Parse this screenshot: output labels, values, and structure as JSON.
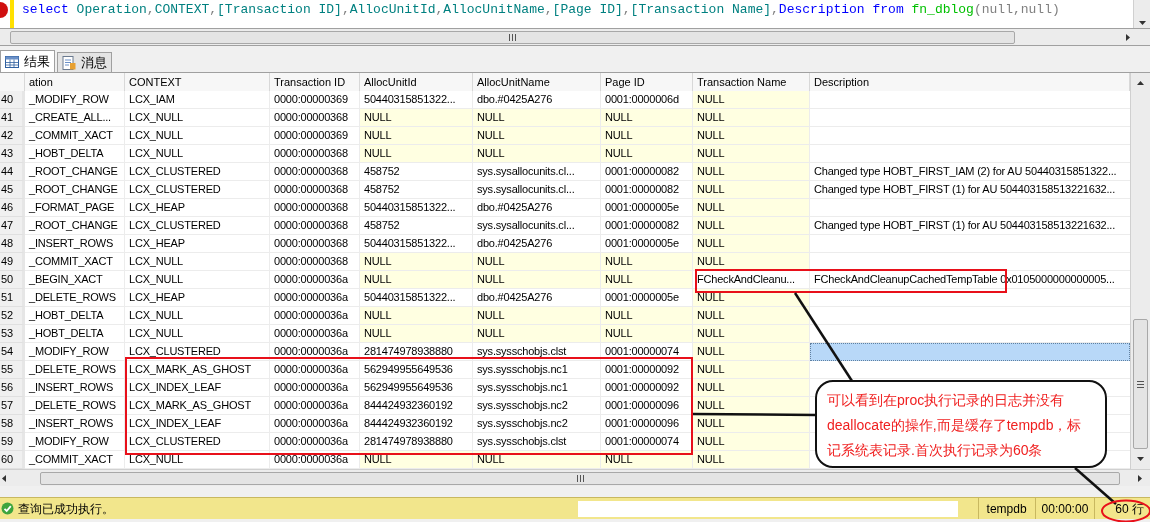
{
  "editor": {
    "code": [
      {
        "text": "select ",
        "kind": "keyword"
      },
      {
        "text": "Operation",
        "kind": "identifier"
      },
      {
        "text": ",",
        "kind": "punct"
      },
      {
        "text": "CONTEXT",
        "kind": "identifier"
      },
      {
        "text": ",",
        "kind": "punct"
      },
      {
        "text": "[Transaction ID]",
        "kind": "identifier"
      },
      {
        "text": ",",
        "kind": "punct"
      },
      {
        "text": "AllocUnitId",
        "kind": "identifier"
      },
      {
        "text": ",",
        "kind": "punct"
      },
      {
        "text": "AllocUnitName",
        "kind": "identifier"
      },
      {
        "text": ",",
        "kind": "punct"
      },
      {
        "text": "[Page ID]",
        "kind": "identifier"
      },
      {
        "text": ",",
        "kind": "punct"
      },
      {
        "text": "[Transaction Name]",
        "kind": "identifier"
      },
      {
        "text": ",",
        "kind": "punct"
      },
      {
        "text": "Description ",
        "kind": "keyword"
      },
      {
        "text": "from ",
        "kind": "keyword"
      },
      {
        "text": "fn_dblog",
        "kind": "function"
      },
      {
        "text": "(null,null)",
        "kind": "punct"
      }
    ]
  },
  "tabs": [
    {
      "label": "结果",
      "selected": true
    },
    {
      "label": "消息",
      "selected": false
    }
  ],
  "grid": {
    "columns": [
      "ation",
      "CONTEXT",
      "Transaction ID",
      "AllocUnitId",
      "AllocUnitName",
      "Page ID",
      "Transaction Name",
      "Description"
    ],
    "rows": [
      {
        "number": "40",
        "cells": [
          "_MODIFY_ROW",
          "LCX_IAM",
          "0000:00000369",
          "50440315851322...",
          "dbo.#0425A276",
          "0001:0000006d",
          "NULL"
        ],
        "shaded": [
          false,
          false,
          false,
          false,
          false,
          false,
          true
        ],
        "selected": false
      },
      {
        "number": "41",
        "cells": [
          "_CREATE_ALL...",
          "LCX_NULL",
          "0000:00000368",
          "NULL",
          "NULL",
          "NULL",
          "NULL"
        ],
        "shaded": [
          false,
          false,
          false,
          true,
          true,
          true,
          true
        ],
        "selected": false
      },
      {
        "number": "42",
        "cells": [
          "_COMMIT_XACT",
          "LCX_NULL",
          "0000:00000369",
          "NULL",
          "NULL",
          "NULL",
          "NULL"
        ],
        "shaded": [
          false,
          false,
          false,
          true,
          true,
          true,
          true
        ],
        "selected": false
      },
      {
        "number": "43",
        "cells": [
          "_HOBT_DELTA",
          "LCX_NULL",
          "0000:00000368",
          "NULL",
          "NULL",
          "NULL",
          "NULL"
        ],
        "shaded": [
          false,
          false,
          false,
          true,
          true,
          true,
          true
        ],
        "selected": false
      },
      {
        "number": "44",
        "cells": [
          "_ROOT_CHANGE",
          "LCX_CLUSTERED",
          "0000:00000368",
          "458752",
          "sys.sysallocunits.cl...",
          "0001:00000082",
          "NULL"
        ],
        "description": "Changed type HOBT_FIRST_IAM (2) for AU 50440315851322...",
        "shaded": [
          false,
          false,
          false,
          false,
          false,
          false,
          true
        ],
        "selected": false
      },
      {
        "number": "45",
        "cells": [
          "_ROOT_CHANGE",
          "LCX_CLUSTERED",
          "0000:00000368",
          "458752",
          "sys.sysallocunits.cl...",
          "0001:00000082",
          "NULL"
        ],
        "description": "Changed type HOBT_FIRST (1) for AU 504403158513221632...",
        "shaded": [
          false,
          false,
          false,
          false,
          false,
          false,
          true
        ],
        "selected": false
      },
      {
        "number": "46",
        "cells": [
          "_FORMAT_PAGE",
          "LCX_HEAP",
          "0000:00000368",
          "50440315851322...",
          "dbo.#0425A276",
          "0001:0000005e",
          "NULL"
        ],
        "shaded": [
          false,
          false,
          false,
          false,
          false,
          false,
          true
        ],
        "selected": false
      },
      {
        "number": "47",
        "cells": [
          "_ROOT_CHANGE",
          "LCX_CLUSTERED",
          "0000:00000368",
          "458752",
          "sys.sysallocunits.cl...",
          "0001:00000082",
          "NULL"
        ],
        "description": "Changed type HOBT_FIRST (1) for AU 504403158513221632...",
        "shaded": [
          false,
          false,
          false,
          false,
          false,
          false,
          true
        ],
        "selected": false
      },
      {
        "number": "48",
        "cells": [
          "_INSERT_ROWS",
          "LCX_HEAP",
          "0000:00000368",
          "50440315851322...",
          "dbo.#0425A276",
          "0001:0000005e",
          "NULL"
        ],
        "shaded": [
          false,
          false,
          false,
          false,
          false,
          false,
          true
        ],
        "selected": false
      },
      {
        "number": "49",
        "cells": [
          "_COMMIT_XACT",
          "LCX_NULL",
          "0000:00000368",
          "NULL",
          "NULL",
          "NULL",
          "NULL"
        ],
        "shaded": [
          false,
          false,
          false,
          true,
          true,
          true,
          true
        ],
        "selected": false
      },
      {
        "number": "50",
        "cells": [
          "_BEGIN_XACT",
          "LCX_NULL",
          "0000:0000036a",
          "NULL",
          "NULL",
          "NULL",
          "FCheckAndCleanu..."
        ],
        "description": "FCheckAndCleanupCachedTempTable 0x0105000000000005...",
        "shaded": [
          false,
          false,
          false,
          true,
          true,
          true,
          false
        ],
        "selected": false
      },
      {
        "number": "51",
        "cells": [
          "_DELETE_ROWS",
          "LCX_HEAP",
          "0000:0000036a",
          "50440315851322...",
          "dbo.#0425A276",
          "0001:0000005e",
          "NULL"
        ],
        "shaded": [
          false,
          false,
          false,
          false,
          false,
          false,
          true
        ],
        "selected": false
      },
      {
        "number": "52",
        "cells": [
          "_HOBT_DELTA",
          "LCX_NULL",
          "0000:0000036a",
          "NULL",
          "NULL",
          "NULL",
          "NULL"
        ],
        "shaded": [
          false,
          false,
          false,
          true,
          true,
          true,
          true
        ],
        "selected": false
      },
      {
        "number": "53",
        "cells": [
          "_HOBT_DELTA",
          "LCX_NULL",
          "0000:0000036a",
          "NULL",
          "NULL",
          "NULL",
          "NULL"
        ],
        "shaded": [
          false,
          false,
          false,
          true,
          true,
          true,
          true
        ],
        "selected": false
      },
      {
        "number": "54",
        "cells": [
          "_MODIFY_ROW",
          "LCX_CLUSTERED",
          "0000:0000036a",
          "281474978938880",
          "sys.sysschobjs.clst",
          "0001:00000074",
          "NULL"
        ],
        "shaded": [
          false,
          false,
          false,
          false,
          false,
          false,
          true
        ],
        "selected": true
      },
      {
        "number": "55",
        "cells": [
          "_DELETE_ROWS",
          "LCX_MARK_AS_GHOST",
          "0000:0000036a",
          "562949955649536",
          "sys.sysschobjs.nc1",
          "0001:00000092",
          "NULL"
        ],
        "shaded": [
          false,
          false,
          false,
          false,
          false,
          false,
          true
        ],
        "selected": false
      },
      {
        "number": "56",
        "cells": [
          "_INSERT_ROWS",
          "LCX_INDEX_LEAF",
          "0000:0000036a",
          "562949955649536",
          "sys.sysschobjs.nc1",
          "0001:00000092",
          "NULL"
        ],
        "shaded": [
          false,
          false,
          false,
          false,
          false,
          false,
          true
        ],
        "selected": false
      },
      {
        "number": "57",
        "cells": [
          "_DELETE_ROWS",
          "LCX_MARK_AS_GHOST",
          "0000:0000036a",
          "844424932360192",
          "sys.sysschobjs.nc2",
          "0001:00000096",
          "NULL"
        ],
        "shaded": [
          false,
          false,
          false,
          false,
          false,
          false,
          true
        ],
        "selected": false
      },
      {
        "number": "58",
        "cells": [
          "_INSERT_ROWS",
          "LCX_INDEX_LEAF",
          "0000:0000036a",
          "844424932360192",
          "sys.sysschobjs.nc2",
          "0001:00000096",
          "NULL"
        ],
        "shaded": [
          false,
          false,
          false,
          false,
          false,
          false,
          true
        ],
        "selected": false
      },
      {
        "number": "59",
        "cells": [
          "_MODIFY_ROW",
          "LCX_CLUSTERED",
          "0000:0000036a",
          "281474978938880",
          "sys.sysschobjs.clst",
          "0001:00000074",
          "NULL"
        ],
        "shaded": [
          false,
          false,
          false,
          false,
          false,
          false,
          true
        ],
        "selected": false
      },
      {
        "number": "60",
        "cells": [
          "_COMMIT_XACT",
          "LCX_NULL",
          "0000:0000036a",
          "NULL",
          "NULL",
          "NULL",
          "NULL"
        ],
        "shaded": [
          false,
          false,
          false,
          true,
          true,
          true,
          true
        ],
        "selected": false
      }
    ]
  },
  "annotation": {
    "text": "可以看到在proc执行记录的日志并没有deallocate的操作,而是缓存了tempdb，标记系统表记录.首次执行记录为60条"
  },
  "status_bar": {
    "message": "查询已成功执行。",
    "database": "tempdb",
    "elapsed": "00:00:00",
    "rows": "60 行"
  }
}
